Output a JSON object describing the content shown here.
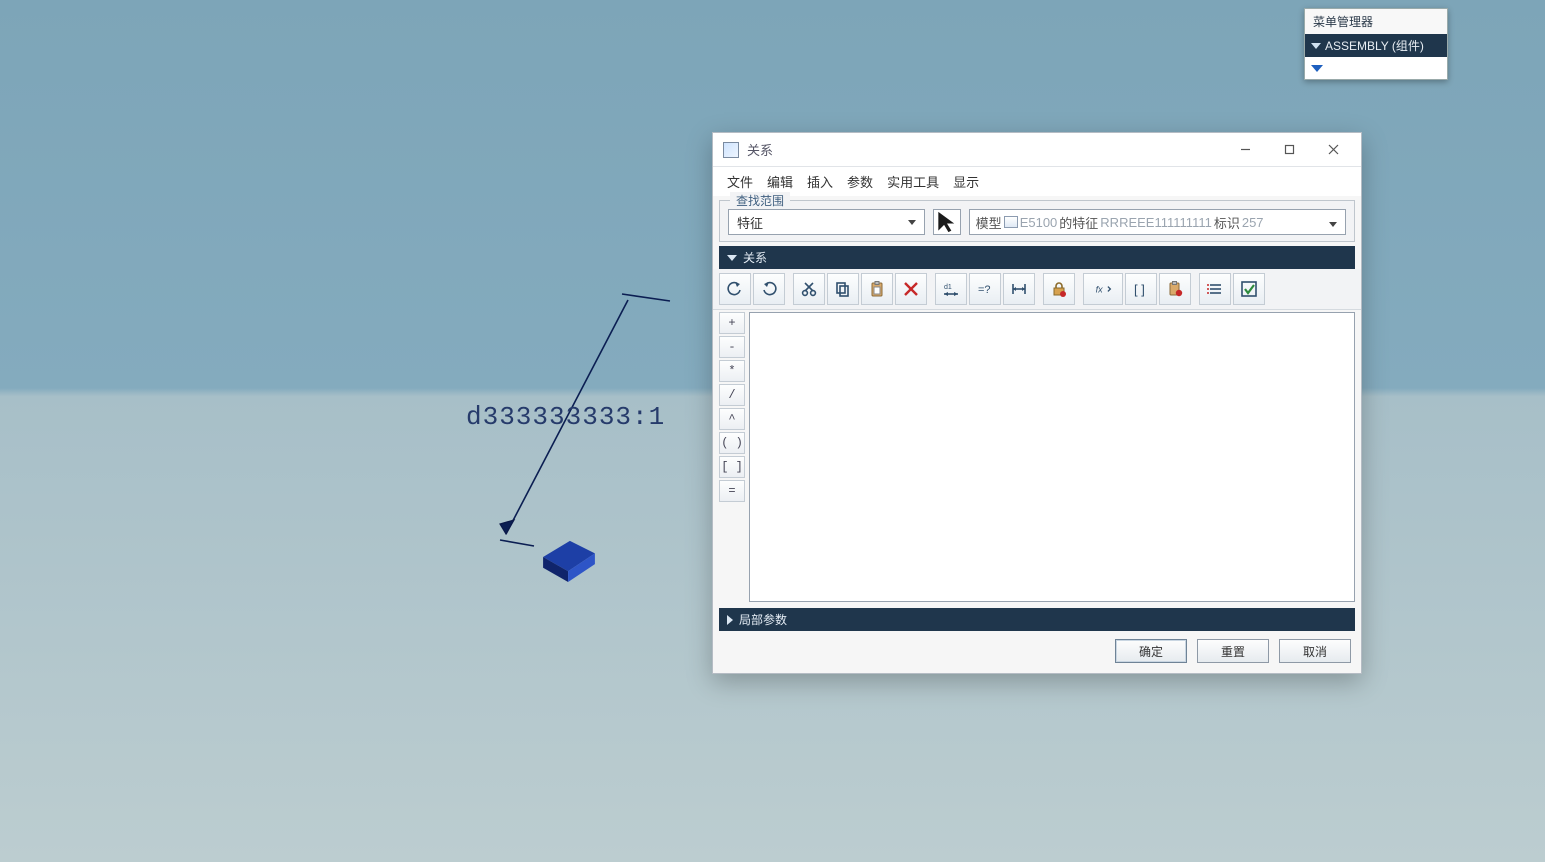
{
  "viewport": {
    "dim_label": "d333333333:1"
  },
  "menu_manager": {
    "title": "菜单管理器",
    "header": "ASSEMBLY (组件)"
  },
  "dialog": {
    "title": "关系",
    "menubar": [
      "文件",
      "编辑",
      "插入",
      "参数",
      "实用工具",
      "显示"
    ],
    "scope": {
      "legend": "查找范围",
      "combo_value": "特征",
      "field": {
        "prefix": "模型",
        "gray1": "E5100",
        "mid": "的特征",
        "gray2": "RRREEE111111111",
        "suffix": "标识",
        "gray3": "257"
      }
    },
    "section1": "关系",
    "section2": "局部参数",
    "operators": [
      "+",
      "-",
      "*",
      "/",
      "^",
      "( )",
      "[ ]",
      "="
    ],
    "buttons": {
      "ok": "确定",
      "reset": "重置",
      "cancel": "取消"
    },
    "toolbar_names": [
      "undo-icon",
      "redo-icon",
      "cut-icon",
      "copy-icon",
      "paste-icon",
      "delete-icon",
      "dim-tool-icon",
      "equals-question-icon",
      "dimension-icon",
      "lock-icon",
      "fx-icon",
      "brackets-icon",
      "clipboard-badge-icon",
      "list-icon",
      "check-icon"
    ]
  }
}
